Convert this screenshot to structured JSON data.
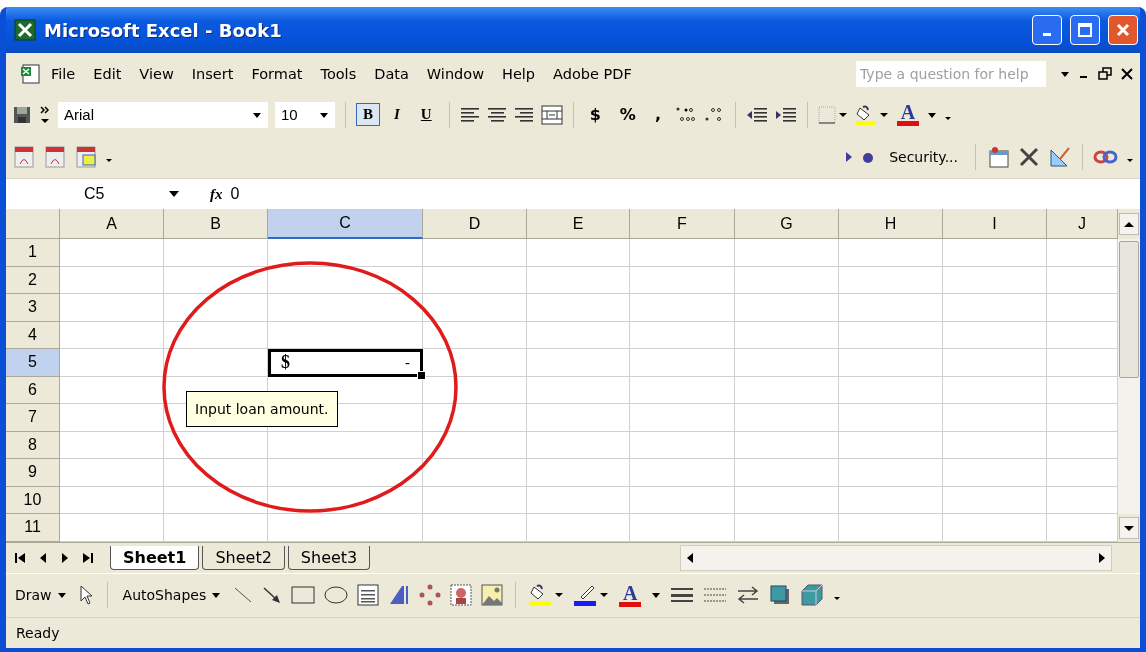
{
  "window": {
    "title": "Microsoft Excel - Book1"
  },
  "menu": [
    "File",
    "Edit",
    "View",
    "Insert",
    "Format",
    "Tools",
    "Data",
    "Window",
    "Help",
    "Adobe PDF"
  ],
  "help_box": {
    "placeholder": "Type a question for help"
  },
  "formatting_toolbar": {
    "font": "Arial",
    "size": "10",
    "styles": [
      {
        "label": "B",
        "selected": true
      },
      {
        "label": "I",
        "selected": false
      },
      {
        "label": "U",
        "selected": false
      }
    ],
    "number_formats": [
      "$",
      "%",
      ","
    ],
    "font_color": "A"
  },
  "adobe_toolbar": {
    "security": "Security..."
  },
  "formula_bar": {
    "name_box": "C5",
    "fx": "fx",
    "formula": "0"
  },
  "sheet": {
    "columns": [
      {
        "label": "A",
        "selected": false
      },
      {
        "label": "B",
        "selected": false
      },
      {
        "label": "C",
        "selected": true
      },
      {
        "label": "D",
        "selected": false
      },
      {
        "label": "E",
        "selected": false
      },
      {
        "label": "F",
        "selected": false
      },
      {
        "label": "G",
        "selected": false
      },
      {
        "label": "H",
        "selected": false
      },
      {
        "label": "I",
        "selected": false
      },
      {
        "label": "J",
        "selected": false
      }
    ],
    "rows": [
      {
        "label": "1",
        "selected": false
      },
      {
        "label": "2",
        "selected": false
      },
      {
        "label": "3",
        "selected": false
      },
      {
        "label": "4",
        "selected": false
      },
      {
        "label": "5",
        "selected": true,
        "active_cell": {
          "symbol": "$",
          "value": "-"
        }
      },
      {
        "label": "6",
        "selected": false
      },
      {
        "label": "7",
        "selected": false
      },
      {
        "label": "8",
        "selected": false
      },
      {
        "label": "9",
        "selected": false
      },
      {
        "label": "10",
        "selected": false
      },
      {
        "label": "11",
        "selected": false
      }
    ],
    "comment": "Input loan amount."
  },
  "sheet_tabs": [
    {
      "label": "Sheet1",
      "selected": true
    },
    {
      "label": "Sheet2",
      "selected": false
    },
    {
      "label": "Sheet3",
      "selected": false
    }
  ],
  "draw_toolbar": {
    "draw": "Draw",
    "autoshapes": "AutoShapes",
    "font_color": "A"
  },
  "status_bar": {
    "text": "Ready"
  }
}
